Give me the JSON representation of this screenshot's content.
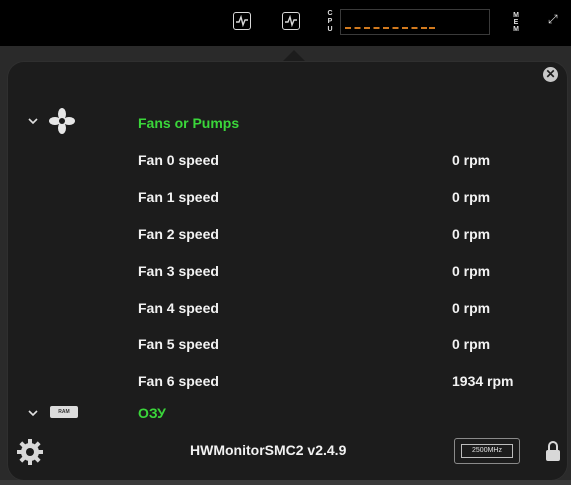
{
  "menubar": {
    "cpu_letters": [
      "C",
      "P",
      "U"
    ],
    "mem_letters": [
      "M",
      "E",
      "M"
    ],
    "icons": [
      "activity-monitor-icon",
      "activity-monitor-active-icon",
      "cpu-graph",
      "memory-label",
      "expand-icon"
    ]
  },
  "panel": {
    "sections": [
      {
        "title": "Fans or Pumps",
        "icon": "fan-icon",
        "expanded": true,
        "rows": [
          {
            "label": "Fan 0 speed",
            "value": "0 rpm"
          },
          {
            "label": "Fan 1 speed",
            "value": "0 rpm"
          },
          {
            "label": "Fan 2 speed",
            "value": "0 rpm"
          },
          {
            "label": "Fan 3 speed",
            "value": "0 rpm"
          },
          {
            "label": "Fan 4 speed",
            "value": "0 rpm"
          },
          {
            "label": "Fan 5 speed",
            "value": "0 rpm"
          },
          {
            "label": "Fan 6 speed",
            "value": "1934 rpm"
          }
        ]
      },
      {
        "title": "ОЗУ",
        "icon": "ram-icon",
        "expanded": true,
        "icon_text": "RAM",
        "rows": []
      }
    ]
  },
  "footer": {
    "title": "HWMonitorSMC2 v2.4.9",
    "freq": "2500MHz"
  },
  "colors": {
    "section_title": "#3ad63a",
    "graph": "#d27a1e",
    "panel_bg": "#1c1c1c"
  }
}
